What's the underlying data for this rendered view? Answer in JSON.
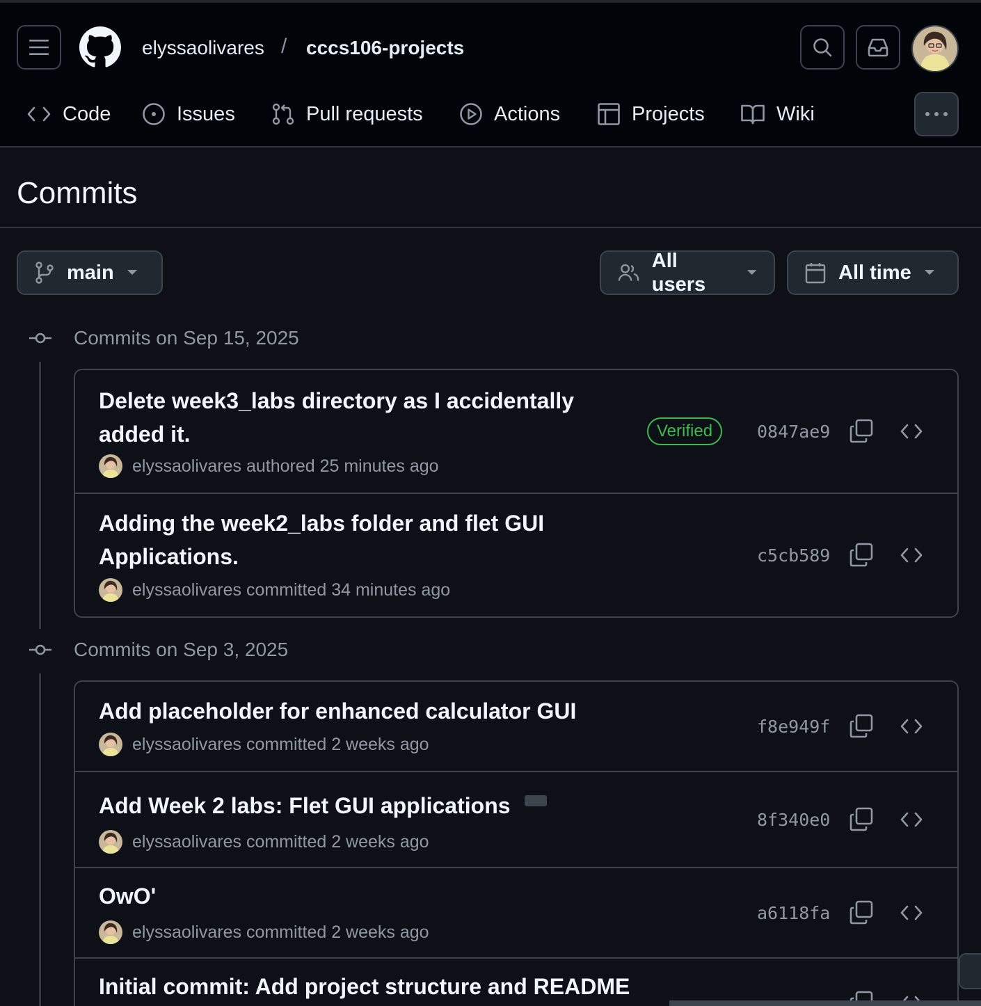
{
  "header": {
    "repo_owner": "elyssaolivares",
    "slash": "/",
    "repo_name": "cccs106-projects"
  },
  "nav": {
    "items": [
      {
        "label": "Code",
        "icon": "code-icon"
      },
      {
        "label": "Issues",
        "icon": "issue-opened-icon"
      },
      {
        "label": "Pull requests",
        "icon": "git-pull-request-icon"
      },
      {
        "label": "Actions",
        "icon": "play-icon"
      },
      {
        "label": "Projects",
        "icon": "table-icon"
      },
      {
        "label": "Wiki",
        "icon": "book-icon"
      }
    ]
  },
  "page": {
    "title": "Commits"
  },
  "filters": {
    "branch": "main",
    "users": "All users",
    "time": "All time"
  },
  "groups": [
    {
      "heading": "Commits on Sep 15, 2025",
      "commits": [
        {
          "message": "Delete week3_labs directory as I accidentally added it.",
          "meta": "elyssaolivares authored 25 minutes ago",
          "badge": "Verified",
          "sha": "0847ae9"
        },
        {
          "message": "Adding the week2_labs folder and flet GUI Applications.",
          "meta": "elyssaolivares committed 34 minutes ago",
          "sha": "c5cb589"
        }
      ]
    },
    {
      "heading": "Commits on Sep 3, 2025",
      "commits": [
        {
          "message": "Add placeholder for enhanced calculator GUI",
          "meta": "elyssaolivares committed 2 weeks ago",
          "sha": "f8e949f"
        },
        {
          "message": "Add Week 2 labs: Flet GUI applications",
          "meta": "elyssaolivares committed 2 weeks ago",
          "sha": "8f340e0"
        },
        {
          "message": "OwO'",
          "meta": "elyssaolivares committed 2 weeks ago",
          "sha": "a6118fa"
        },
        {
          "message": "Initial commit: Add project structure and README",
          "meta": "",
          "sha": ""
        }
      ]
    }
  ],
  "colors": {
    "background": "#0d1117",
    "header": "#010409",
    "border": "#3d444d",
    "muted_text": "#9198a1",
    "verified_green": "#3fb950"
  }
}
